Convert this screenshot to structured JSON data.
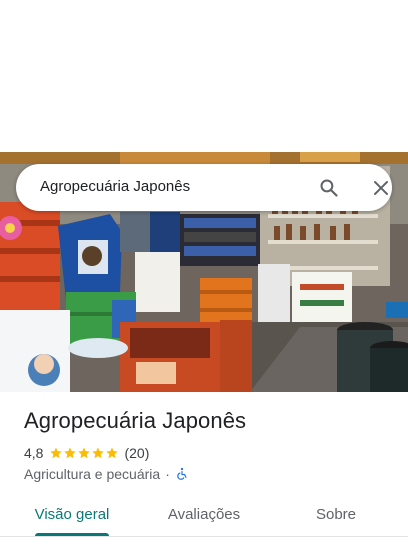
{
  "search": {
    "query": "Agropecuária Japonês"
  },
  "place": {
    "name": "Agropecuária Japonês",
    "rating": "4,8",
    "stars": 5,
    "review_count": "(20)",
    "category": "Agricultura e pecuária",
    "separator": "·"
  },
  "tabs": [
    {
      "label": "Visão geral",
      "active": true
    },
    {
      "label": "Avaliações",
      "active": false
    },
    {
      "label": "Sobre",
      "active": false
    }
  ],
  "colors": {
    "accent": "#0b7878",
    "star": "#fbbc04",
    "accessibility_icon": "#1a73e8"
  },
  "icons": [
    "search-icon",
    "close-icon",
    "star-icon",
    "wheelchair-icon"
  ]
}
